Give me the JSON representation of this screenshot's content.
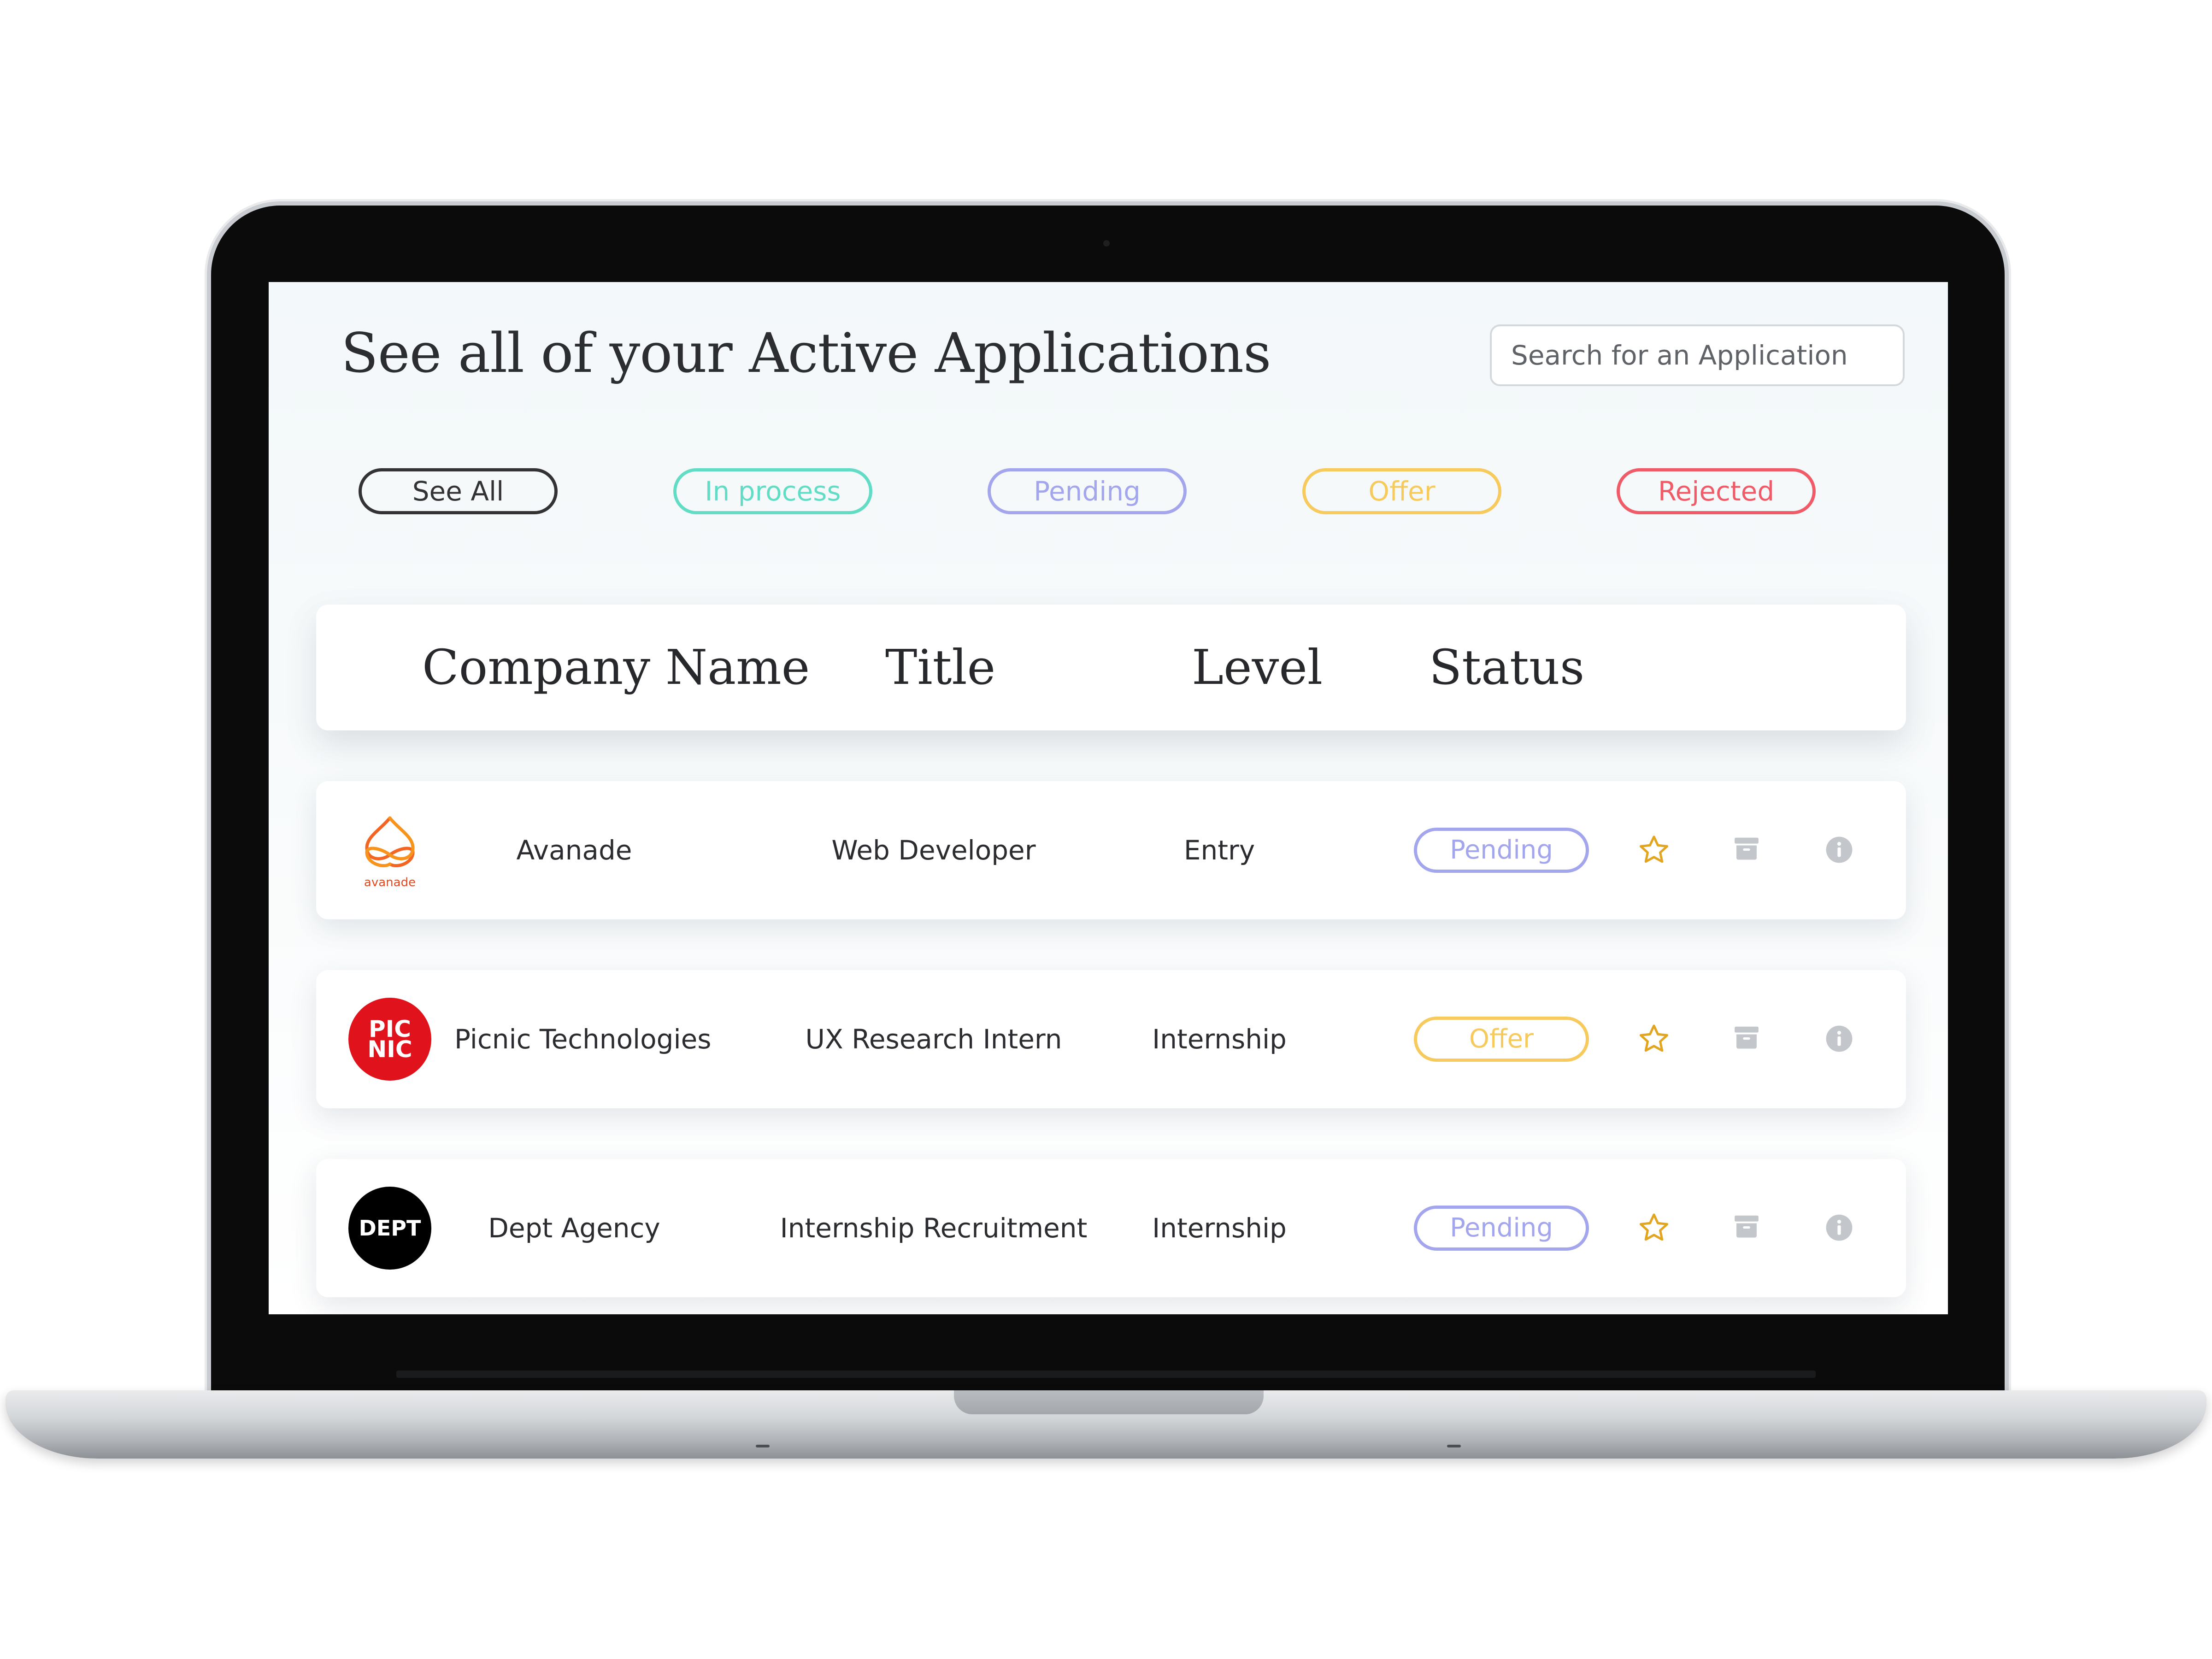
{
  "page": {
    "title": "See all of your Active Applications",
    "search_placeholder": "Search for an Application"
  },
  "filters": [
    {
      "label": "See All",
      "color": "#333333"
    },
    {
      "label": "In process",
      "color": "#62dcc4"
    },
    {
      "label": "Pending",
      "color": "#a3a6ec"
    },
    {
      "label": "Offer",
      "color": "#f6ca5d"
    },
    {
      "label": "Rejected",
      "color": "#ef5c68"
    }
  ],
  "table": {
    "headers": [
      "Company Name",
      "Title",
      "Level",
      "Status"
    ],
    "rows": [
      {
        "logo_icon": "avanade-logo",
        "logo_text": "avanade",
        "company": "Avanade",
        "title": "Web Developer",
        "level": "Entry",
        "status": "Pending",
        "status_color": "#a3a6ec"
      },
      {
        "logo_icon": "picnic-logo",
        "logo_text": "PIC NIC",
        "company": "Picnic Technologies",
        "title": "UX Research Intern",
        "level": "Internship",
        "status": "Offer",
        "status_color": "#f6ca5d"
      },
      {
        "logo_icon": "dept-logo",
        "logo_text": "DEPT",
        "company": "Dept Agency",
        "title": "Internship Recruitment",
        "level": "Internship",
        "status": "Pending",
        "status_color": "#a3a6ec"
      }
    ]
  },
  "icons": {
    "favorite": "star-icon",
    "archive": "archive-icon",
    "info": "info-icon"
  },
  "colors": {
    "star": "#e2a520",
    "muted_icon": "#c3c6ca",
    "picnic_red": "#e0121b",
    "avanade_orange": "#f26522",
    "dept_black": "#000000"
  }
}
